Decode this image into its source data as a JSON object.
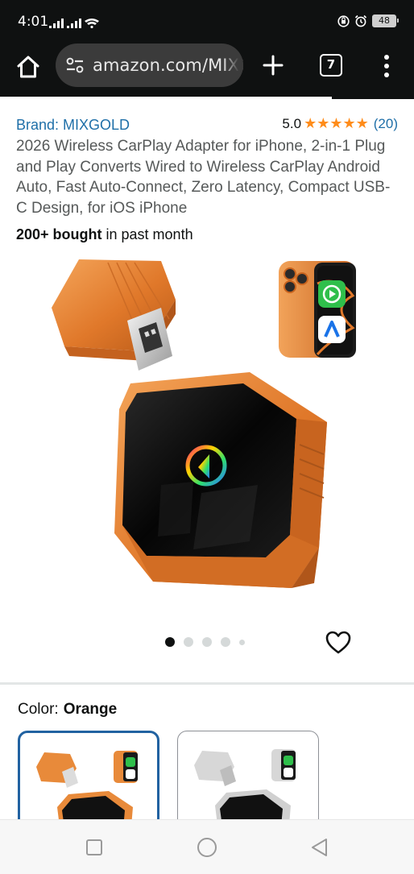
{
  "status_bar": {
    "time": "4:01",
    "battery": "48",
    "icons": [
      "signal-icon",
      "signal-icon",
      "wifi-icon",
      "do-not-disturb-icon",
      "alarm-icon",
      "battery-icon"
    ]
  },
  "browser": {
    "url": "amazon.com/MIXGOLD",
    "tab_count": "7",
    "icons": [
      "home-icon",
      "site-settings-icon",
      "new-tab-icon",
      "tab-switcher-icon",
      "menu-icon"
    ]
  },
  "product": {
    "brand": "Brand: MIXGOLD",
    "rating_value": "5.0",
    "rating_stars": 5,
    "rating_count": "(20)",
    "title": "2026 Wireless CarPlay Adapter for iPhone, 2-in-1 Plug and Play Converts Wired to Wireless CarPlay Android Auto, Fast Auto-Connect, Zero Latency, Compact USB-C Design, for iOS iPhone",
    "bought_bold": "200+ bought",
    "bought_rest": " in past month"
  },
  "gallery": {
    "image_count": 5,
    "active_index": 0
  },
  "variants": {
    "label": "Color:",
    "selected": "Orange",
    "options": [
      "orange-variant",
      "silver-variant"
    ]
  },
  "colors": {
    "bar_bg": "#0f1111",
    "link": "#1f6fa8",
    "star": "#ff8c1a",
    "device_orange": "#e88a3a",
    "selected_border": "#2162a1"
  },
  "nav": {
    "icons": [
      "recents-icon",
      "home-nav-icon",
      "back-icon"
    ]
  }
}
